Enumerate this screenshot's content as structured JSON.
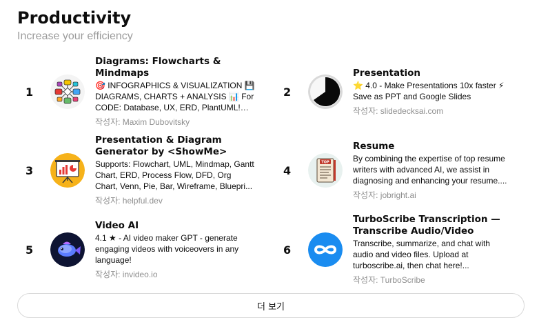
{
  "section": {
    "title": "Productivity",
    "subtitle": "Increase your efficiency"
  },
  "items": [
    {
      "rank": "1",
      "name": "Diagrams: Flowcharts & Mindmaps",
      "description": "🎯 INFOGRAPHICS & VISUALIZATION 💾 DIAGRAMS, CHARTS + ANALYSIS 📊 For CODE: Database, UX, ERD, PlantUML! Fo...",
      "author": "작성자: Maxim Dubovitsky",
      "icon": "flowchart-icon"
    },
    {
      "rank": "2",
      "name": "Presentation",
      "description": "⭐ 4.0 - Make Presentations 10x faster ⚡ Save as PPT and Google Slides",
      "author": "작성자: slidedecksai.com",
      "icon": "pie-slice-icon"
    },
    {
      "rank": "3",
      "name": "Presentation & Diagram Generator by <ShowMe>",
      "description": "Supports: Flowchart, UML, Mindmap, Gantt Chart, ERD, Process Flow, DFD, Org Chart, Venn, Pie, Bar, Wireframe, Bluepri...",
      "author": "작성자: helpful.dev",
      "icon": "presentation-board-icon"
    },
    {
      "rank": "4",
      "name": "Resume",
      "description": "By combining the expertise of top resume writers with advanced AI, we assist in diagnosing and enhancing your resume....",
      "author": "작성자: jobright.ai",
      "icon": "resume-document-icon"
    },
    {
      "rank": "5",
      "name": "Video AI",
      "description": "4.1 ★ - AI video maker GPT - generate engaging videos with voiceovers in any language!",
      "author": "작성자: invideo.io",
      "icon": "video-ai-fish-icon"
    },
    {
      "rank": "6",
      "name": "TurboScribe Transcription — Transcribe Audio/Video",
      "description": "Transcribe, summarize, and chat with audio and video files. Upload at turboscribe.ai, then chat here!...",
      "author": "작성자: TurboScribe",
      "icon": "infinity-icon"
    }
  ],
  "more_button": {
    "label": "더 보기"
  },
  "colors": {
    "text": "#0d0d0d",
    "muted": "#8e8e8e",
    "subtitle": "#9b9b9b",
    "border": "#d9d9d9",
    "turboscribe_blue": "#1a8cf0"
  }
}
